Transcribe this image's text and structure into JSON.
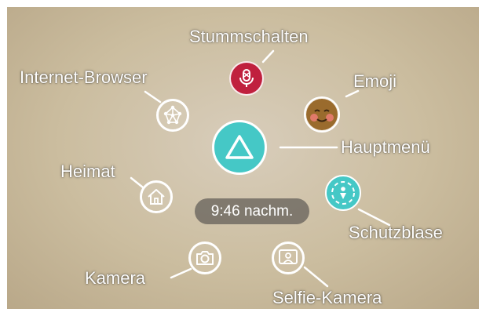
{
  "colors": {
    "accent_teal": "#45c8c6",
    "mute_red": "#c0203e",
    "emoji_face": "#9a6b2d",
    "emoji_cheek": "#e07a6a",
    "label_text": "#ffffff"
  },
  "menu": {
    "center": {
      "label": "Hauptmenü",
      "icon": "triangle-icon"
    },
    "items": [
      {
        "label": "Stummschalten",
        "icon": "muted-microphone-icon"
      },
      {
        "label": "Emoji",
        "icon": "emoji-face-icon"
      },
      {
        "label": "Schutzblase",
        "icon": "safety-bubble-icon"
      },
      {
        "label": "Selfie-Kamera",
        "icon": "selfie-camera-icon"
      },
      {
        "label": "Kamera",
        "icon": "camera-icon"
      },
      {
        "label": "Heimat",
        "icon": "home-icon"
      },
      {
        "label": "Internet-Browser",
        "icon": "network-globe-icon"
      }
    ]
  },
  "status": {
    "time": "9:46 nachm."
  }
}
